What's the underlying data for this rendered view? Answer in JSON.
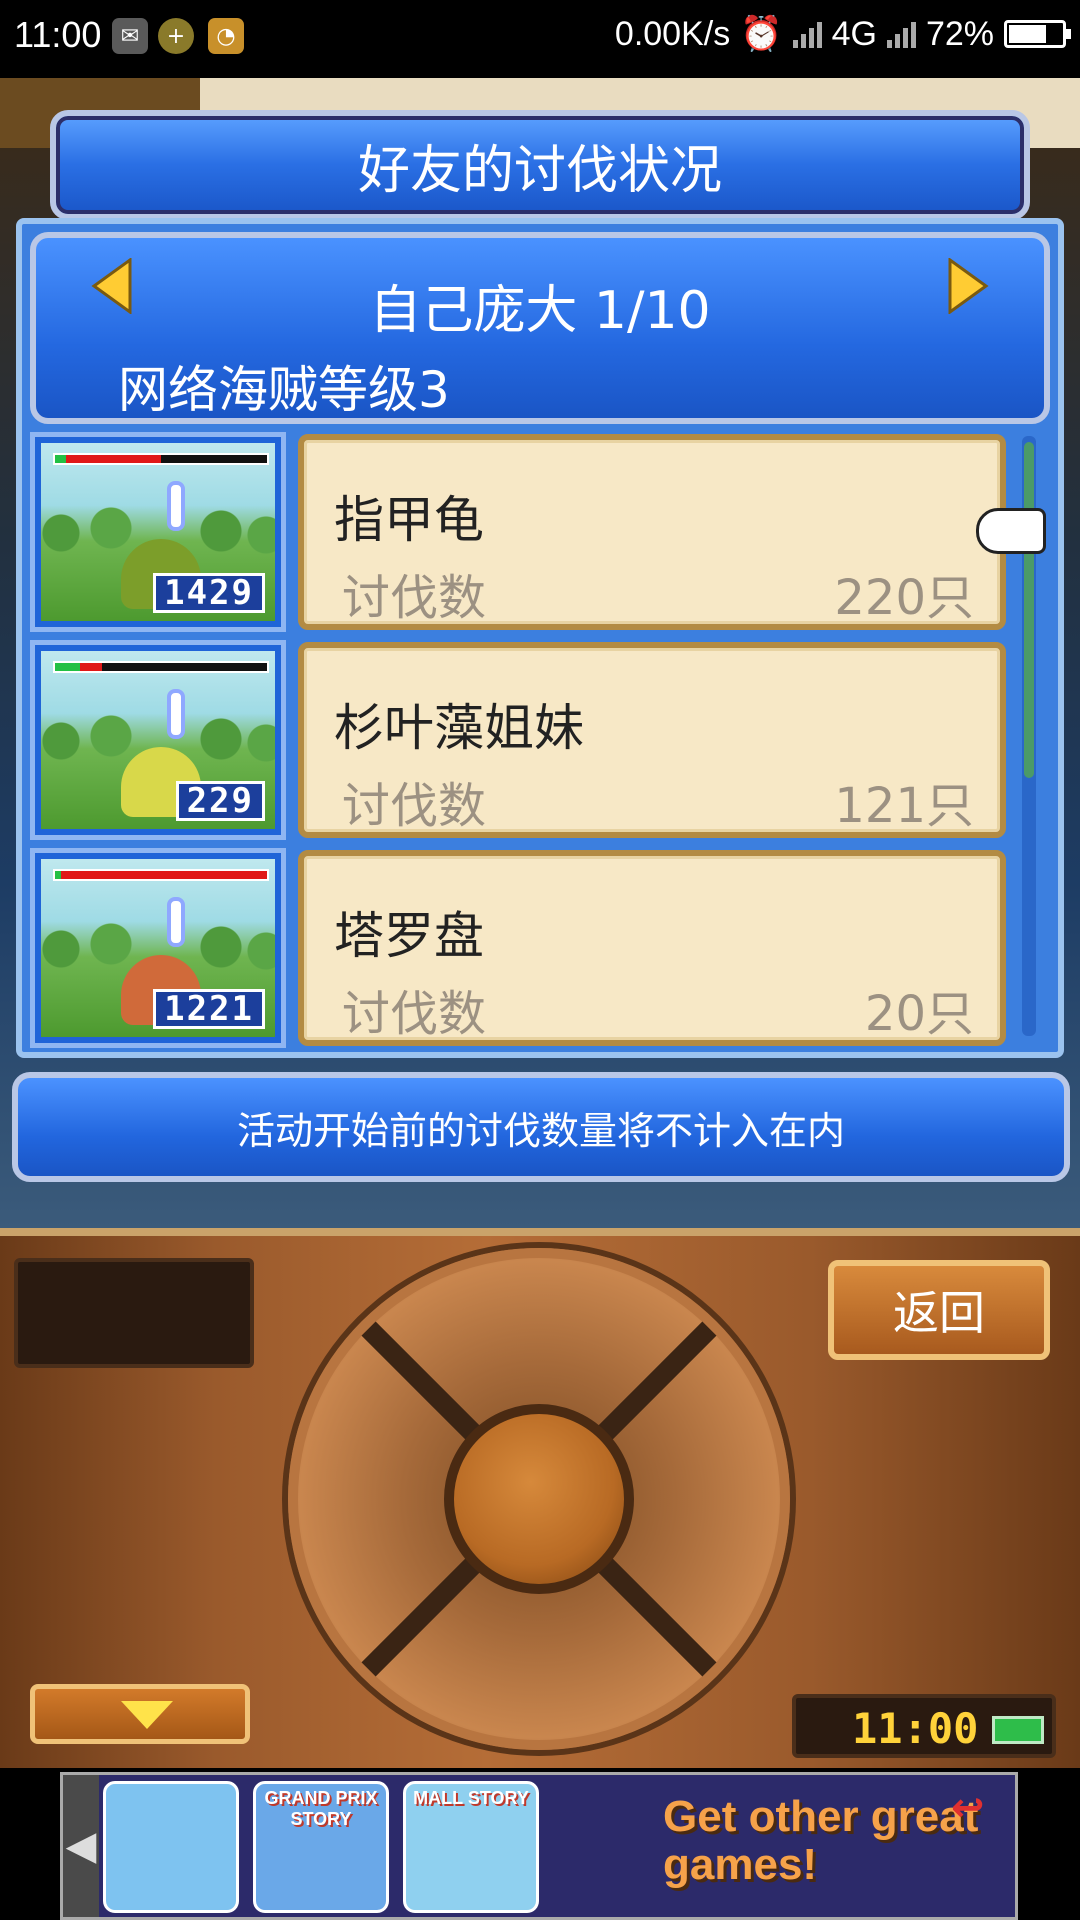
{
  "status_bar": {
    "time": "11:00",
    "network_speed": "0.00K/s",
    "network_type": "4G",
    "battery_percent": "72%",
    "battery_level": 0.72,
    "icons": [
      "wechat-icon",
      "plus-icon",
      "app-icon",
      "alarm-icon",
      "signal-icon",
      "battery-icon"
    ]
  },
  "modal": {
    "title": "好友的讨伐状况",
    "header": {
      "name_count": "自己庞大 1/10",
      "level": "网络海贼等级3"
    },
    "rows": [
      {
        "monster_name": "指甲龟",
        "label": "讨伐数",
        "value": "220只",
        "badge_number": "1429",
        "hp_green": 0.05,
        "hp_red": 0.45,
        "monster_color": "#7c9e2a"
      },
      {
        "monster_name": "杉叶藻姐妹",
        "label": "讨伐数",
        "value": "121只",
        "badge_number": "229",
        "hp_green": 0.12,
        "hp_red": 0.1,
        "monster_color": "#d8d84a"
      },
      {
        "monster_name": "塔罗盘",
        "label": "讨伐数",
        "value": "20只",
        "badge_number": "1221",
        "hp_green": 0.03,
        "hp_red": 0.97,
        "monster_color": "#d06a3a"
      }
    ],
    "footer_note": "活动开始前的讨伐数量将不计入在内"
  },
  "controls": {
    "back_label": "返回",
    "clock": "11:00"
  },
  "ad": {
    "tiles": [
      {
        "title": "",
        "color": "#7ec3f0"
      },
      {
        "title": "GRAND PRIX STORY",
        "color": "#6aa8e8"
      },
      {
        "title": "MALL STORY",
        "color": "#8fd0ef"
      }
    ],
    "slogan": "Get other great games!"
  },
  "colors": {
    "accent_blue": "#2a6fe4",
    "card_bg": "#f7e8c6",
    "wood": "#b56d37"
  }
}
